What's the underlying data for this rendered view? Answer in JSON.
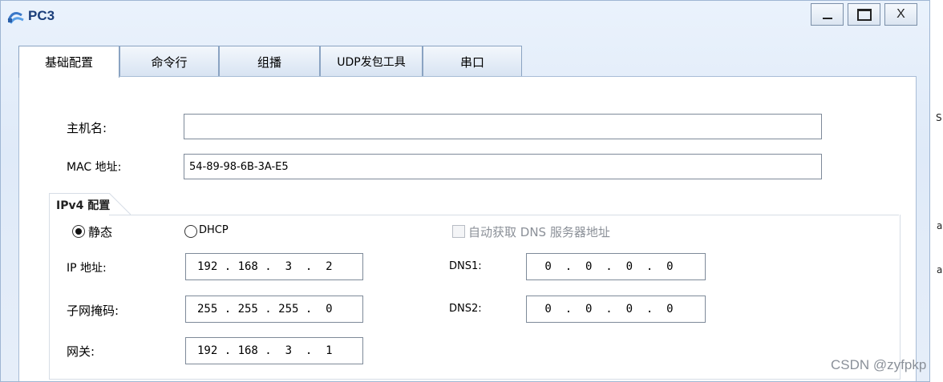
{
  "window": {
    "title": "PC3"
  },
  "controls": {
    "minimize": "_",
    "close": "X"
  },
  "tabs": [
    {
      "label": "基础配置",
      "active": true
    },
    {
      "label": "命令行",
      "active": false
    },
    {
      "label": "组播",
      "active": false
    },
    {
      "label": "UDP发包工具",
      "active": false
    },
    {
      "label": "串口",
      "active": false
    }
  ],
  "form": {
    "hostname_label": "主机名:",
    "hostname_value": "",
    "mac_label": "MAC 地址:",
    "mac_value": "54-89-98-6B-3A-E5"
  },
  "ipv4": {
    "title": "IPv4 配置",
    "static_label": "静态",
    "static_selected": true,
    "dhcp_label": "DHCP",
    "dhcp_selected": false,
    "auto_dns_label": "自动获取 DNS 服务器地址",
    "auto_dns_checked": false,
    "ip_label": "IP 地址:",
    "ip_value": "192 . 168 .  3  .  2",
    "mask_label": "子网掩码:",
    "mask_value": "255 . 255 . 255 .  0",
    "gateway_label": "网关:",
    "gateway_value": "192 . 168 .  3  .  1",
    "dns1_label": "DNS1:",
    "dns1_value": " 0  .  0  .  0  .  0",
    "dns2_label": "DNS2:",
    "dns2_value": " 0  .  0  .  0  .  0"
  },
  "side_fragments": [
    "S",
    "a",
    "a"
  ],
  "watermark": "CSDN @zyfpkp"
}
